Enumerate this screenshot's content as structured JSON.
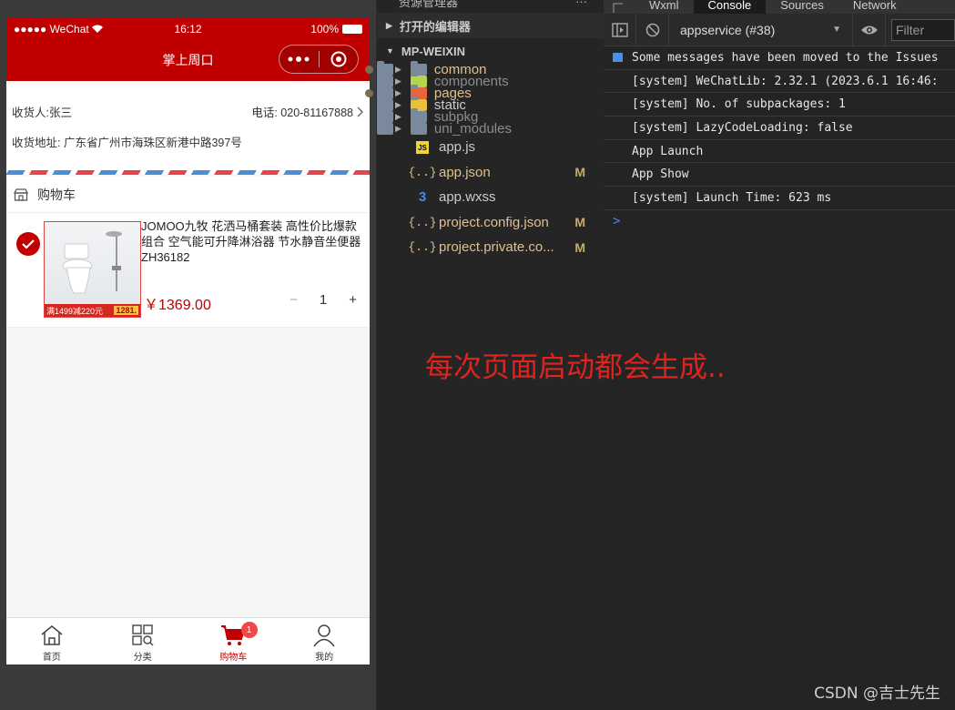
{
  "simulator": {
    "status": {
      "carrier": "●●●●● WeChat",
      "time": "16:12",
      "battery": "100%"
    },
    "nav_title": "掌上周口",
    "address": {
      "consignee": "收货人:张三",
      "phone": "电话: 020-81167888",
      "detail": "收货地址: 广东省广州市海珠区新港中路397号"
    },
    "cart_title": "购物车",
    "item": {
      "title": "JOMOO九牧 花洒马桶套装 高性价比爆款组合 空气能可升降淋浴器 节水静音坐便器 ZH36182",
      "price": "￥1369.00",
      "quantity": "1",
      "minus": "−",
      "plus": "+",
      "img_promo": "满1499减220元",
      "img_price": "1281."
    },
    "tabs": [
      {
        "label": "首页",
        "icon": "home-icon"
      },
      {
        "label": "分类",
        "icon": "category-icon"
      },
      {
        "label": "购物车",
        "icon": "cart-icon",
        "badge": "1",
        "active": true
      },
      {
        "label": "我的",
        "icon": "user-icon"
      }
    ],
    "colors": {
      "brand": "#c00000",
      "badge": "#f04848"
    }
  },
  "explorer": {
    "title": "资源管理器",
    "more": "···",
    "open_editors": "打开的编辑器",
    "project": "MP-WEIXIN",
    "items": [
      {
        "name": "common",
        "type": "folder",
        "color": "#e2c08d",
        "marker": "dot"
      },
      {
        "name": "components",
        "type": "folder",
        "color": "#8c8c8c",
        "marker": ""
      },
      {
        "name": "pages",
        "type": "folder",
        "color": "#e2c08d",
        "marker": "dot"
      },
      {
        "name": "static",
        "type": "folder",
        "color": "#cccccc",
        "marker": ""
      },
      {
        "name": "subpkg",
        "type": "folder",
        "color": "#8c8c8c",
        "marker": ""
      },
      {
        "name": "uni_modules",
        "type": "folder",
        "color": "#8c8c8c",
        "marker": ""
      },
      {
        "name": "app.js",
        "type": "file",
        "color": "#cccccc",
        "marker": ""
      },
      {
        "name": "app.json",
        "type": "file",
        "color": "#e2c08d",
        "marker": "M"
      },
      {
        "name": "app.wxss",
        "type": "file",
        "color": "#cccccc",
        "marker": ""
      },
      {
        "name": "project.config.json",
        "type": "file",
        "color": "#e2c08d",
        "marker": "M"
      },
      {
        "name": "project.private.co...",
        "type": "file",
        "color": "#e2c08d",
        "marker": "M"
      }
    ]
  },
  "devtools": {
    "tabs": [
      "Wxml",
      "Console",
      "Sources",
      "Network"
    ],
    "active_tab": "Console",
    "context": "appservice (#38)",
    "filter_placeholder": "Filter",
    "logs": [
      "Some messages have been moved to the Issues",
      "[system] WeChatLib: 2.32.1 (2023.6.1 16:46:",
      "[system] No. of subpackages: 1",
      "[system] LazyCodeLoading: false",
      "App Launch",
      "App Show",
      "[system] Launch Time: 623 ms"
    ],
    "prompt": ">"
  },
  "overlay_note": "每次页面启动都会生成..",
  "watermark": "CSDN @吉士先生"
}
